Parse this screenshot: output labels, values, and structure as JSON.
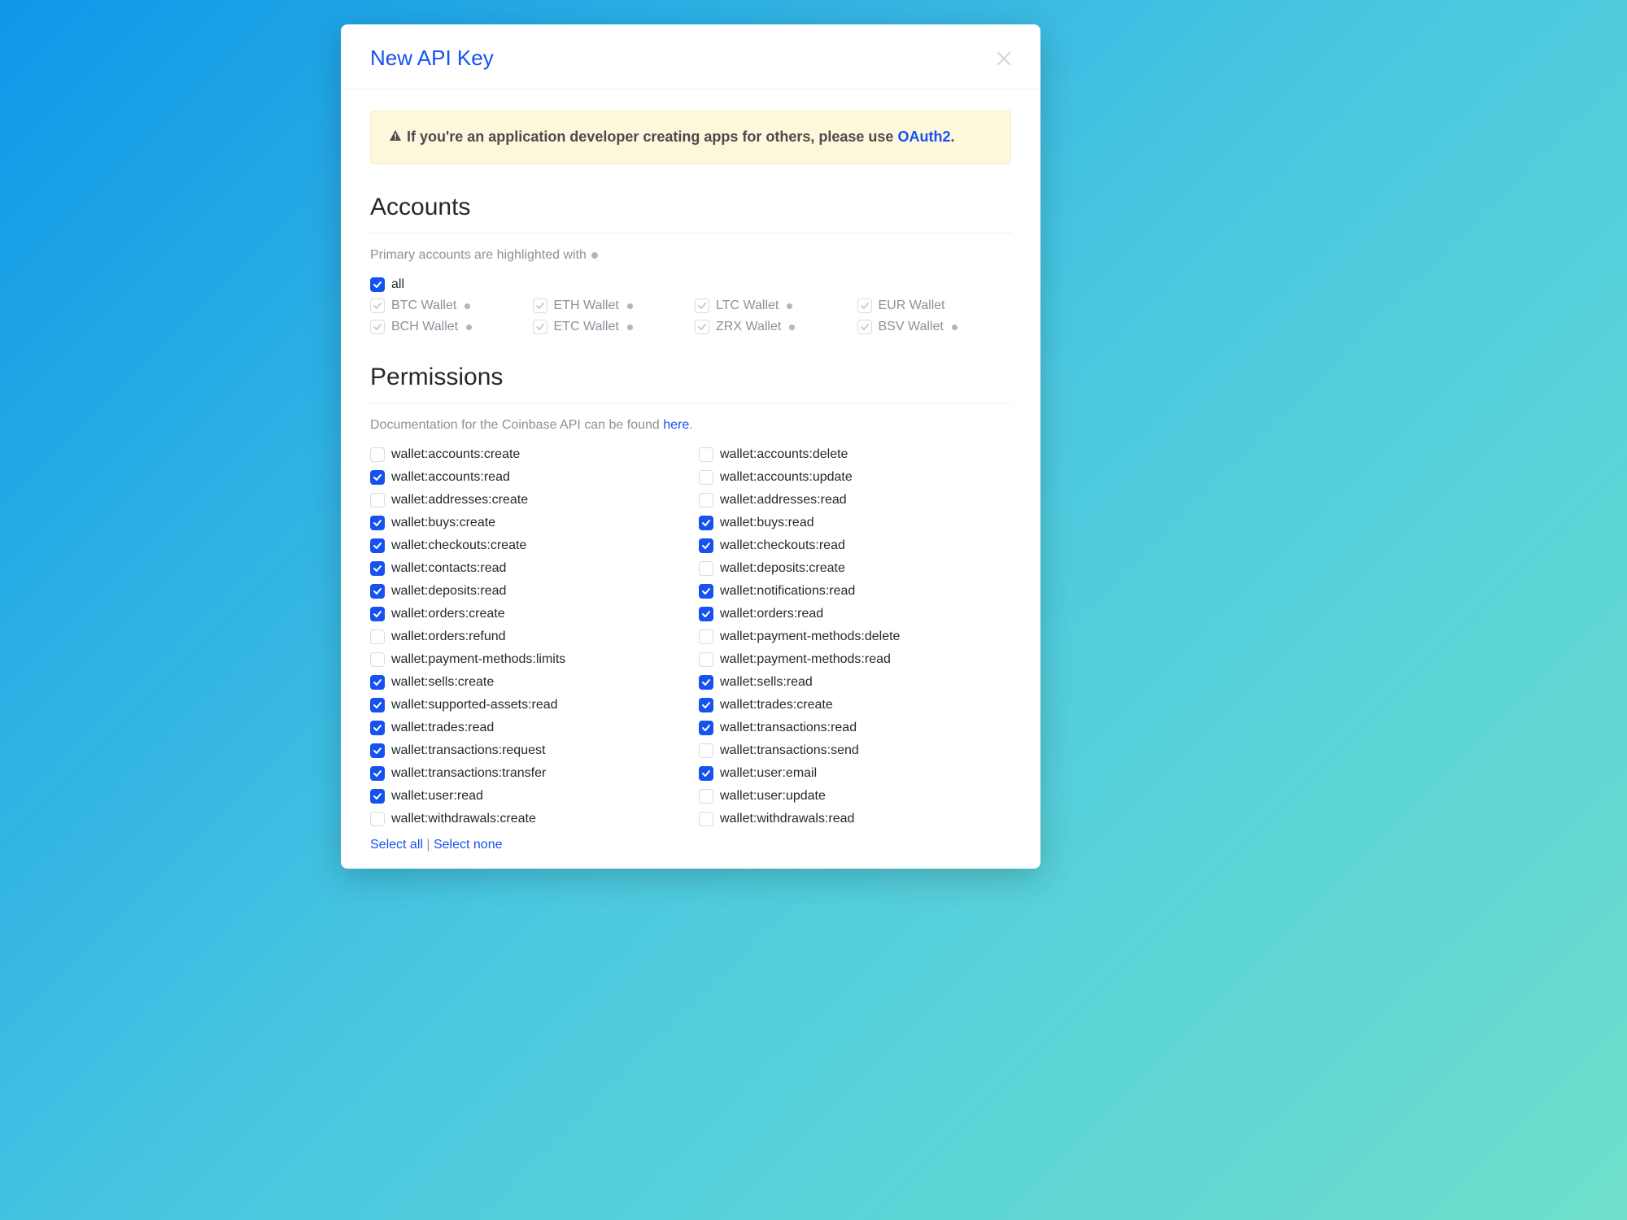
{
  "modal": {
    "title": "New API Key",
    "alert": {
      "text_before_link": "If you're an application developer creating apps for others, please use ",
      "link_text": "OAuth2",
      "text_after_link": "."
    }
  },
  "accounts": {
    "section_title": "Accounts",
    "subnote": "Primary accounts are highlighted with",
    "all_label": "all",
    "items": [
      {
        "label": "BTC Wallet",
        "primary": true
      },
      {
        "label": "ETH Wallet",
        "primary": true
      },
      {
        "label": "LTC Wallet",
        "primary": true
      },
      {
        "label": "EUR Wallet",
        "primary": false
      },
      {
        "label": "BCH Wallet",
        "primary": true
      },
      {
        "label": "ETC Wallet",
        "primary": true
      },
      {
        "label": "ZRX Wallet",
        "primary": true
      },
      {
        "label": "BSV Wallet",
        "primary": true
      }
    ]
  },
  "permissions": {
    "section_title": "Permissions",
    "doc_text_before": "Documentation for the Coinbase API can be found ",
    "doc_link": "here",
    "doc_text_after": ".",
    "select_all": "Select all",
    "select_none": "Select none",
    "items": [
      {
        "label": "wallet:accounts:create",
        "checked": false
      },
      {
        "label": "wallet:accounts:delete",
        "checked": false
      },
      {
        "label": "wallet:accounts:read",
        "checked": true
      },
      {
        "label": "wallet:accounts:update",
        "checked": false
      },
      {
        "label": "wallet:addresses:create",
        "checked": false
      },
      {
        "label": "wallet:addresses:read",
        "checked": false
      },
      {
        "label": "wallet:buys:create",
        "checked": true
      },
      {
        "label": "wallet:buys:read",
        "checked": true
      },
      {
        "label": "wallet:checkouts:create",
        "checked": true
      },
      {
        "label": "wallet:checkouts:read",
        "checked": true
      },
      {
        "label": "wallet:contacts:read",
        "checked": true
      },
      {
        "label": "wallet:deposits:create",
        "checked": false
      },
      {
        "label": "wallet:deposits:read",
        "checked": true
      },
      {
        "label": "wallet:notifications:read",
        "checked": true
      },
      {
        "label": "wallet:orders:create",
        "checked": true
      },
      {
        "label": "wallet:orders:read",
        "checked": true
      },
      {
        "label": "wallet:orders:refund",
        "checked": false
      },
      {
        "label": "wallet:payment-methods:delete",
        "checked": false
      },
      {
        "label": "wallet:payment-methods:limits",
        "checked": false
      },
      {
        "label": "wallet:payment-methods:read",
        "checked": false
      },
      {
        "label": "wallet:sells:create",
        "checked": true
      },
      {
        "label": "wallet:sells:read",
        "checked": true
      },
      {
        "label": "wallet:supported-assets:read",
        "checked": true
      },
      {
        "label": "wallet:trades:create",
        "checked": true
      },
      {
        "label": "wallet:trades:read",
        "checked": true
      },
      {
        "label": "wallet:transactions:read",
        "checked": true
      },
      {
        "label": "wallet:transactions:request",
        "checked": true
      },
      {
        "label": "wallet:transactions:send",
        "checked": false
      },
      {
        "label": "wallet:transactions:transfer",
        "checked": true
      },
      {
        "label": "wallet:user:email",
        "checked": true
      },
      {
        "label": "wallet:user:read",
        "checked": true
      },
      {
        "label": "wallet:user:update",
        "checked": false
      },
      {
        "label": "wallet:withdrawals:create",
        "checked": false
      },
      {
        "label": "wallet:withdrawals:read",
        "checked": false
      }
    ]
  }
}
